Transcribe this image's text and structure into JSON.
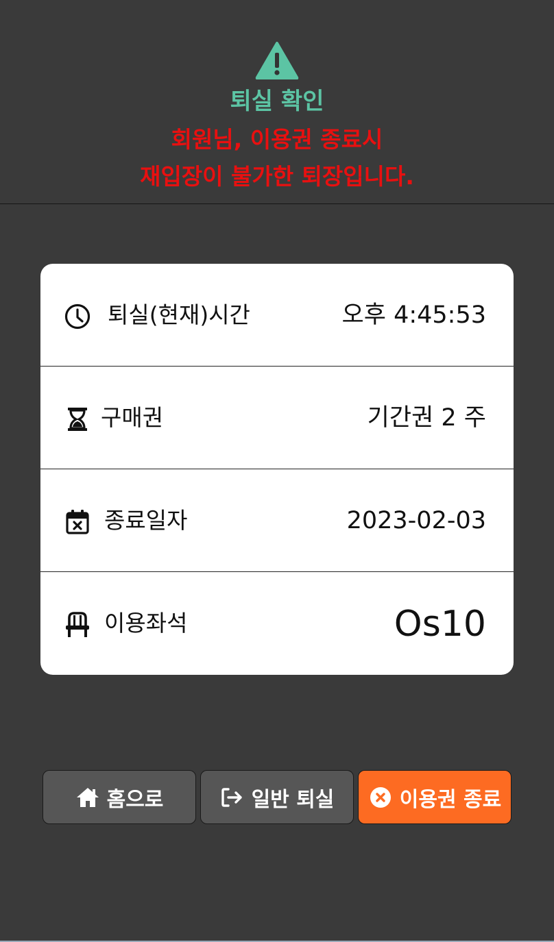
{
  "header": {
    "icon": "warning-icon",
    "title": "퇴실 확인",
    "message_line1": "회원님, 이용권 종료시",
    "message_line2": "재입장이 불가한 퇴장입니다.",
    "colors": {
      "title": "#5cc4a4",
      "message": "#e81010"
    }
  },
  "info": {
    "rows": [
      {
        "icon": "clock-icon",
        "label": "퇴실(현재)시간",
        "value": "오후 4:45:53"
      },
      {
        "icon": "hourglass-icon",
        "label": "구매권",
        "value": "기간권 2 주"
      },
      {
        "icon": "calendar-x-icon",
        "label": "종료일자",
        "value": "2023-02-03"
      },
      {
        "icon": "chair-icon",
        "label": "이용좌석",
        "value": "Os10"
      }
    ]
  },
  "buttons": {
    "home": {
      "icon": "home-icon",
      "label": "홈으로"
    },
    "exit": {
      "icon": "sign-out-icon",
      "label": "일반 퇴실"
    },
    "end": {
      "icon": "close-circle-icon",
      "label": "이용권 종료",
      "color": "#fd6b22"
    }
  }
}
